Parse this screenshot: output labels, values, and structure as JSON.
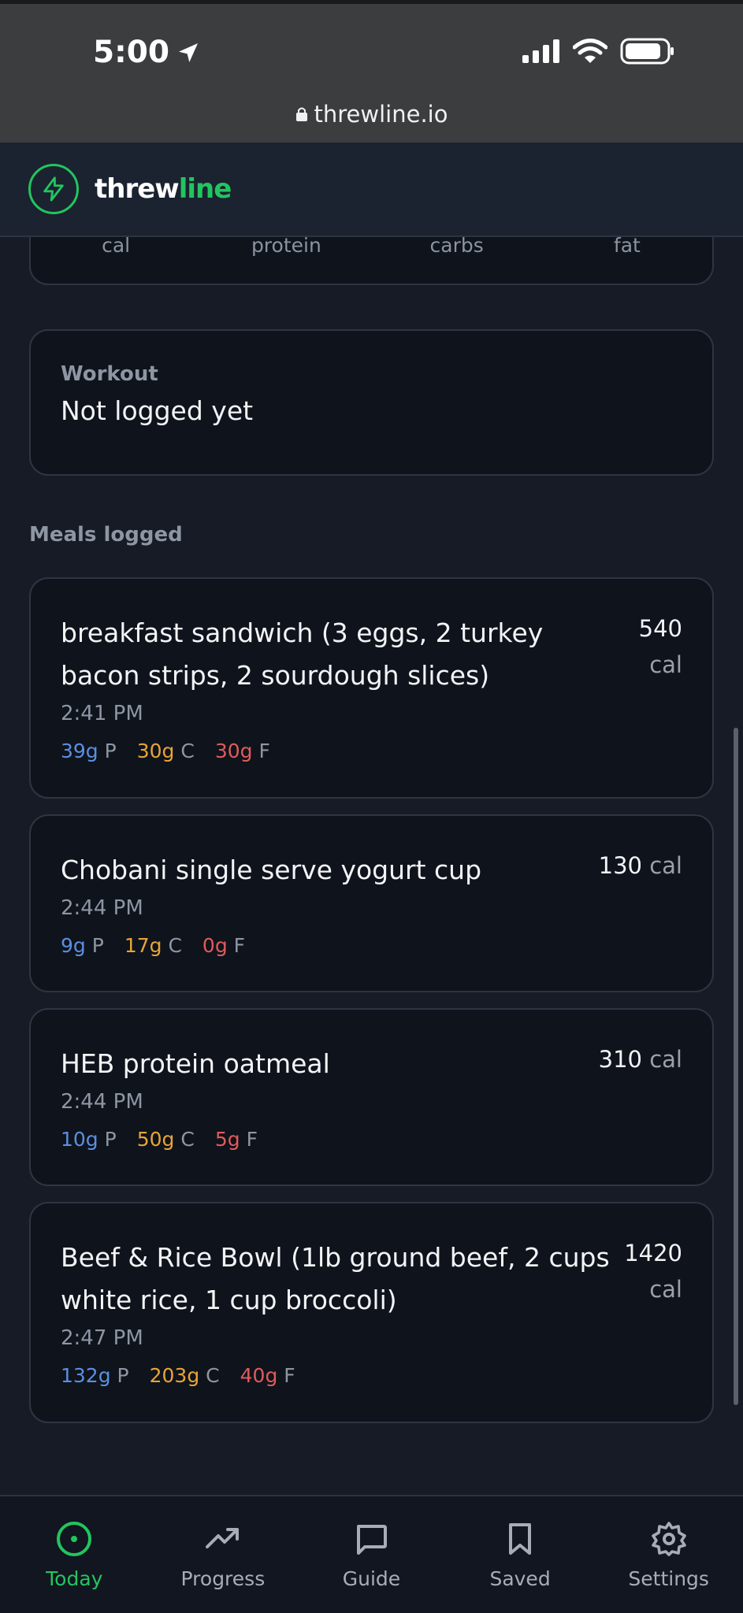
{
  "status": {
    "time": "5:00",
    "url": "threwline.io"
  },
  "brand": {
    "part1": "threw",
    "part2": "line"
  },
  "summary": {
    "labels": [
      "cal",
      "protein",
      "carbs",
      "fat"
    ]
  },
  "workout": {
    "label": "Workout",
    "value": "Not logged yet"
  },
  "meals_label": "Meals logged",
  "meals": [
    {
      "title": "breakfast sandwich (3 eggs, 2 turkey bacon strips, 2 sourdough slices)",
      "cal": "540",
      "cal_unit": "cal",
      "time": "2:41 PM",
      "protein": "39g",
      "carbs": "30g",
      "fat": "30g"
    },
    {
      "title": "Chobani single serve yogurt cup",
      "cal": "130",
      "cal_unit": "cal",
      "time": "2:44 PM",
      "protein": "9g",
      "carbs": "17g",
      "fat": "0g"
    },
    {
      "title": "HEB protein oatmeal",
      "cal": "310",
      "cal_unit": "cal",
      "time": "2:44 PM",
      "protein": "10g",
      "carbs": "50g",
      "fat": "5g"
    },
    {
      "title": "Beef & Rice Bowl (1lb ground beef, 2 cups white rice, 1 cup broccoli)",
      "cal": "1420",
      "cal_unit": "cal",
      "time": "2:47 PM",
      "protein": "132g",
      "carbs": "203g",
      "fat": "40g"
    }
  ],
  "macro_letters": {
    "p": "P",
    "c": "C",
    "f": "F"
  },
  "tabs": [
    {
      "label": "Today",
      "icon": "target-icon",
      "active": true
    },
    {
      "label": "Progress",
      "icon": "trending-up-icon",
      "active": false
    },
    {
      "label": "Guide",
      "icon": "chat-bubble-icon",
      "active": false
    },
    {
      "label": "Saved",
      "icon": "bookmark-icon",
      "active": false
    },
    {
      "label": "Settings",
      "icon": "gear-icon",
      "active": false
    }
  ],
  "colors": {
    "accent": "#22c55e",
    "protein": "#5b8fe0",
    "carbs": "#e7a536",
    "fat": "#e05b5b"
  }
}
